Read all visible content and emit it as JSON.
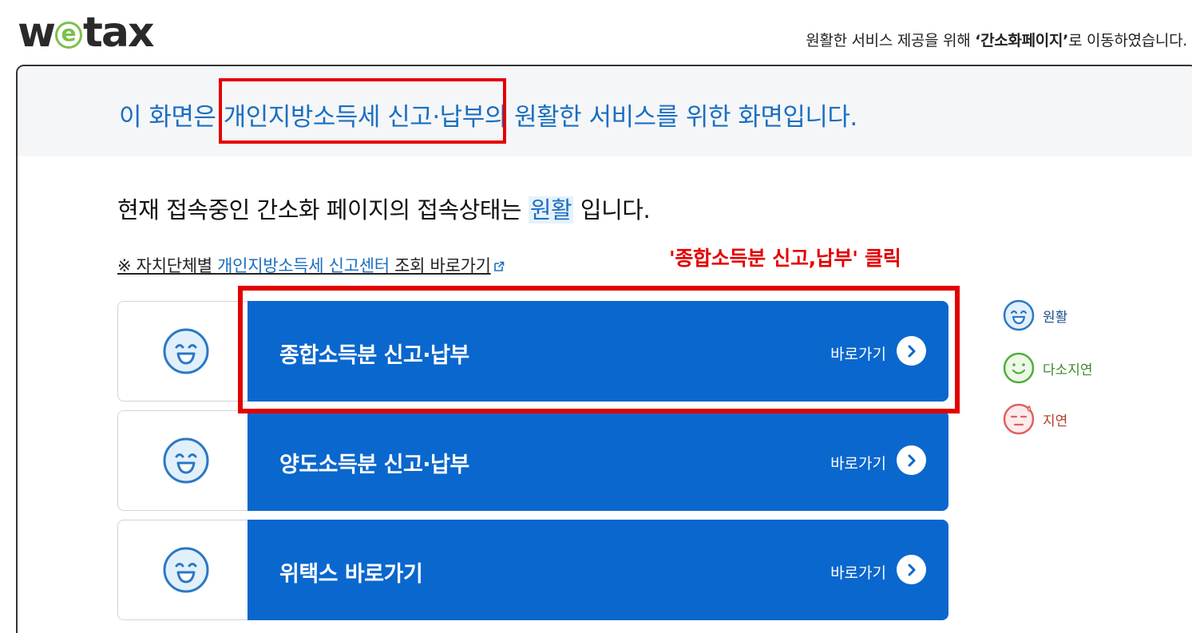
{
  "header": {
    "logo": {
      "w": "w",
      "e": "e",
      "tax": "tax"
    },
    "notice_prefix": "원활한 서비스 제공을 위해 ",
    "notice_bold": "‘간소화페이지’",
    "notice_suffix": "로 이동하였습니다."
  },
  "banner": {
    "headline": "이 화면은 개인지방소득세 신고·납부의 원활한 서비스를 위한 화면입니다."
  },
  "status": {
    "prefix": "현재 접속중인 간소화 페이지의 접속상태는 ",
    "value": "원활",
    "suffix": " 입니다."
  },
  "center_link": {
    "prefix": "※ 자치단체별 ",
    "link_text": "개인지방소득세 신고센터",
    "suffix": " 조회 바로가기",
    "icon": "external-link-icon"
  },
  "annotation": {
    "text": "'종합소득분 신고,납부' 클릭",
    "color": "#e30000"
  },
  "rows": [
    {
      "label": "종합소득분 신고·납부",
      "go_label": "바로가기",
      "status_icon": "smile-face-icon"
    },
    {
      "label": "양도소득분 신고·납부",
      "go_label": "바로가기",
      "status_icon": "smile-face-icon"
    },
    {
      "label": "위택스 바로가기",
      "go_label": "바로가기",
      "status_icon": "smile-face-icon"
    }
  ],
  "legend": [
    {
      "label": "원활",
      "icon": "smile-face-icon",
      "color": "#2b78c4"
    },
    {
      "label": "다소지연",
      "icon": "calm-face-icon",
      "color": "#4caf3a"
    },
    {
      "label": "지연",
      "icon": "sweat-face-icon",
      "color": "#e06060"
    }
  ],
  "colors": {
    "accent": "#0a67cd",
    "text_blue": "#1b6fc0",
    "highlight_red": "#e30000"
  }
}
